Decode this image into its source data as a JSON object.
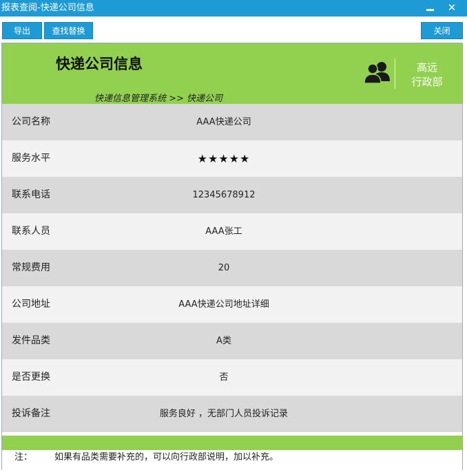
{
  "window": {
    "title": "报表查阅-快递公司信息"
  },
  "toolbar": {
    "export_label": "导出",
    "find_replace_label": "查找替换",
    "close_label": "关闭"
  },
  "header": {
    "title": "快递公司信息",
    "breadcrumb": "快递信息管理系统 >> 快递公司",
    "user_line1": "高远",
    "user_line2": "行政部"
  },
  "rows": [
    {
      "label": "公司名称",
      "value": "AAA快递公司"
    },
    {
      "label": "服务水平",
      "value": "★★★★★"
    },
    {
      "label": "联系电话",
      "value": "12345678912"
    },
    {
      "label": "联系人员",
      "value": "AAA张工"
    },
    {
      "label": "常规费用",
      "value": "20"
    },
    {
      "label": "公司地址",
      "value": "AAA快递公司地址详细"
    },
    {
      "label": "发件品类",
      "value": "A类"
    },
    {
      "label": "是否更换",
      "value": "否"
    },
    {
      "label": "投诉备注",
      "value": "服务良好 ，无部门人员投诉记录"
    }
  ],
  "note": {
    "label": "注：",
    "text": "如果有品类需要补充的，可以向行政部说明，加以补充。"
  },
  "colors": {
    "title_bar": "#1e9ad4",
    "header_green": "#92d050",
    "row_dark": "#d9d9d9",
    "row_light": "#f2f2f2"
  }
}
